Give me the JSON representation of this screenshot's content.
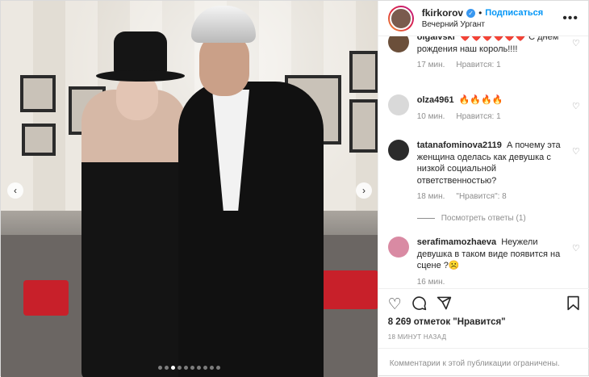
{
  "header": {
    "username": "fkirkorov",
    "verified_icon": "verified-badge-icon",
    "follow_label": "Подписаться",
    "location": "Вечерний Ургант",
    "more_icon": "more-options-icon"
  },
  "media": {
    "prev_icon": "‹",
    "next_icon": "›",
    "dots_count": 10,
    "active_dot": 2
  },
  "comments": [
    {
      "username": "olgalvski",
      "text": "❤️❤️❤️❤️❤️❤️ С днём рождения наш король!!!!",
      "time": "17 мин.",
      "likes": "Нравится: 1",
      "avatar_color": "#6b4f3a"
    },
    {
      "username": "olza4961",
      "text": "🔥🔥🔥🔥",
      "time": "10 мин.",
      "likes": "Нравится: 1",
      "avatar_color": "#d9d9d9"
    },
    {
      "username": "tatanafominova2119",
      "text": "А почему эта женщина оделась как девушка с низкой социальной ответственностью?",
      "time": "18 мин.",
      "likes": "\"Нравится\": 8",
      "avatar_color": "#2b2b2b"
    },
    {
      "username": "serafimamozhaeva",
      "text": "Неужели девушка в таком виде появится на сцене ?☹️",
      "time": "16 мин.",
      "likes": "",
      "avatar_color": "#d98aa3"
    }
  ],
  "view_replies": "Посмотреть ответы (1)",
  "actions": {
    "like_icon": "heart-icon",
    "comment_icon": "comment-icon",
    "share_icon": "share-icon",
    "save_icon": "bookmark-icon"
  },
  "likes_text": "8 269 отметок \"Нравится\"",
  "timestamp": "18 МИНУТ НАЗАД",
  "footer_text": "Комментарии к этой публикации ограничены.",
  "colors": {
    "link": "#0095f6",
    "muted": "#8e8e8e",
    "text": "#262626"
  }
}
